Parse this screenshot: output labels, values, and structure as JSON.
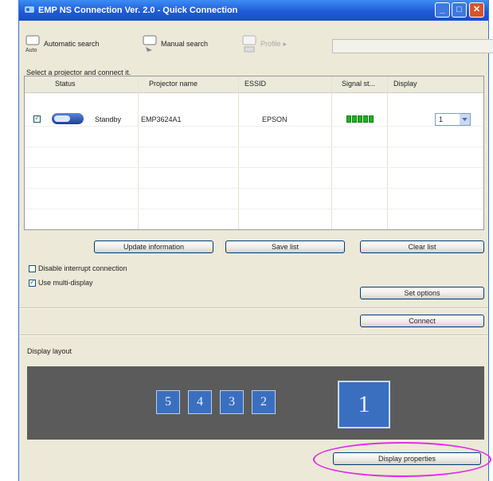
{
  "window": {
    "title": "EMP NS Connection Ver. 2.0 - Quick Connection",
    "controls": {
      "minimize": "_",
      "maximize": "□",
      "close": "✕"
    }
  },
  "toolbar": {
    "auto_label": "Automatic search",
    "manual_label": "Manual search",
    "profile_label": "Profile"
  },
  "hint": "Select a projector and connect it.",
  "table": {
    "headers": [
      "Status",
      "Projector name",
      "ESSID",
      "Signal st...",
      "Display"
    ],
    "rows": [
      {
        "checked": true,
        "status": "Standby",
        "name": "EMP3624A1",
        "essid": "EPSON",
        "signal_bars": 5,
        "display": "1"
      }
    ]
  },
  "buttons": {
    "update": "Update information",
    "save": "Save list",
    "clear": "Clear list",
    "set_options": "Set options",
    "connect": "Connect",
    "display_properties": "Display properties"
  },
  "options": {
    "interrupt_label": "Disable interrupt connection",
    "interrupt_checked": false,
    "multi_label": "Use multi-display",
    "multi_checked": true
  },
  "layout": {
    "label": "Display layout",
    "monitors": [
      "5",
      "4",
      "3",
      "2",
      "1"
    ]
  },
  "colors": {
    "title_bar": "#1f5bd6",
    "callout": "#e22de8",
    "signal": "#22b022"
  }
}
